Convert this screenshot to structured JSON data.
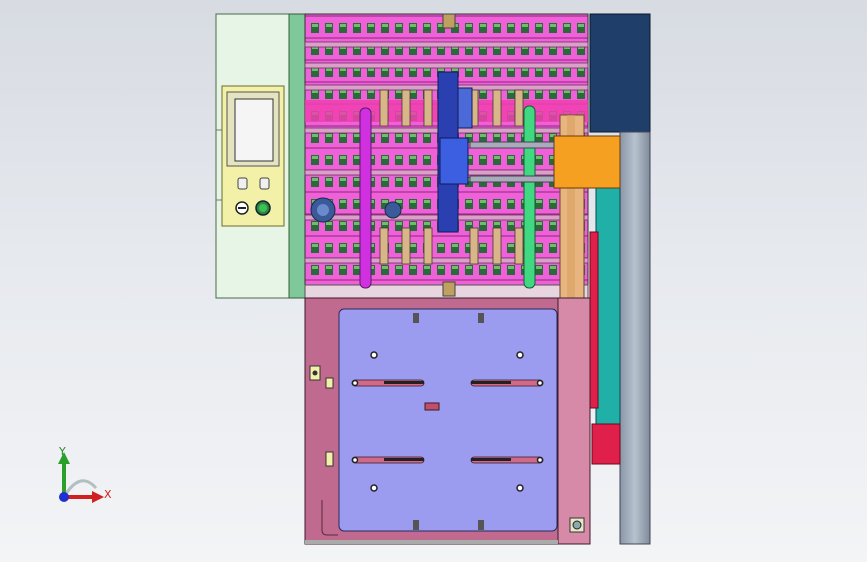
{
  "triad": {
    "y_label": "Y",
    "x_label": "X"
  },
  "colors": {
    "background_top": "#d7dbe2",
    "background_bottom": "#f3f4f6",
    "rack_magenta": "#f060d8",
    "guide_green": "#40d880",
    "plate_lavender": "#9b9bf0",
    "base_rose": "#c06a90",
    "slider_orange": "#f5a020",
    "rail_navy": "#1f3f6a",
    "rail_teal": "#20b0a8",
    "rail_red": "#e0204a",
    "panel_mint": "#e6f5e6",
    "hmi_yellow": "#f3f0a8"
  },
  "icons": [
    "axis-triad-icon",
    "start-button-icon",
    "selector-switch-icon"
  ]
}
